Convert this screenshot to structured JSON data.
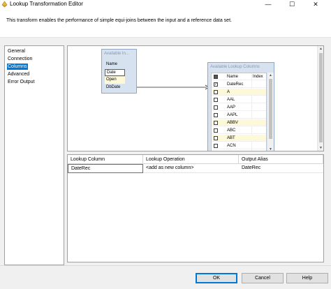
{
  "window": {
    "title": "Lookup Transformation Editor",
    "minimize_glyph": "—",
    "maximize_glyph": "☐",
    "close_glyph": "✕"
  },
  "description": "This transform enables the performance of simple equi-joins between the input and a reference data set.",
  "nav": {
    "items": [
      {
        "label": "General",
        "selected": false
      },
      {
        "label": "Connection",
        "selected": false
      },
      {
        "label": "Columns",
        "selected": true
      },
      {
        "label": "Advanced",
        "selected": false
      },
      {
        "label": "Error Output",
        "selected": false
      }
    ]
  },
  "available_input": {
    "header": "Available In...",
    "columns": [
      "Name",
      "Date",
      "Open",
      "DbDate"
    ]
  },
  "available_lookup": {
    "header": "Available Lookup Columns",
    "col_name": "Name",
    "col_index": "Index",
    "rows": [
      {
        "name": "DateRec",
        "checked": true
      },
      {
        "name": "A",
        "checked": false
      },
      {
        "name": "AAL",
        "checked": false
      },
      {
        "name": "AAP",
        "checked": false
      },
      {
        "name": "AAPL",
        "checked": false
      },
      {
        "name": "ABBV",
        "checked": false
      },
      {
        "name": "ABC",
        "checked": false
      },
      {
        "name": "ABT",
        "checked": false
      },
      {
        "name": "ACN",
        "checked": false
      }
    ]
  },
  "grid": {
    "headers": [
      "Lookup Column",
      "Lookup Operation",
      "Output Alias"
    ],
    "rows": [
      [
        "DateRec",
        "<add as new column>",
        "DateRec"
      ]
    ]
  },
  "buttons": {
    "ok": "OK",
    "cancel": "Cancel",
    "help": "Help"
  },
  "colors": {
    "selection": "#0078d7",
    "box_fill": "#d7e2f0",
    "highlight_row": "#fdf9d8"
  }
}
